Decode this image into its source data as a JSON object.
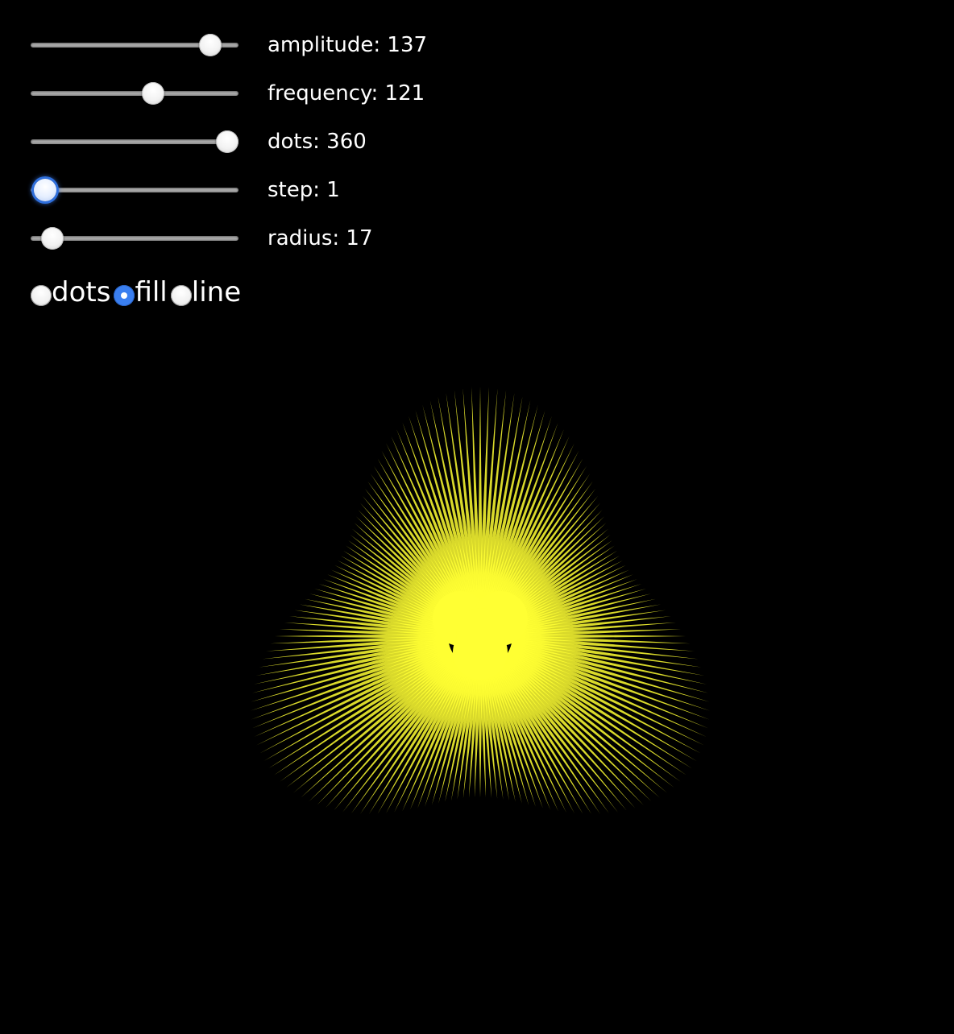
{
  "sliders": [
    {
      "id": "amplitude",
      "label": "amplitude: 137",
      "value": 137,
      "fraction": 0.865,
      "focused": false
    },
    {
      "id": "frequency",
      "label": "frequency: 121",
      "value": 121,
      "fraction": 0.59,
      "focused": false
    },
    {
      "id": "dots",
      "label": "dots: 360",
      "value": 360,
      "fraction": 0.945,
      "focused": false
    },
    {
      "id": "step",
      "label": "step: 1",
      "value": 1,
      "fraction": 0.07,
      "focused": true
    },
    {
      "id": "radius",
      "label": "radius: 17",
      "value": 17,
      "fraction": 0.105,
      "focused": false
    }
  ],
  "modes": {
    "selected": "fill",
    "options": [
      {
        "id": "dots",
        "label": "dots"
      },
      {
        "id": "fill",
        "label": "fill"
      },
      {
        "id": "line",
        "label": "line"
      }
    ]
  },
  "colors": {
    "background": "#000000",
    "stroke": "#ffff33",
    "text": "#ffffff",
    "accent": "#3a7ff0"
  }
}
